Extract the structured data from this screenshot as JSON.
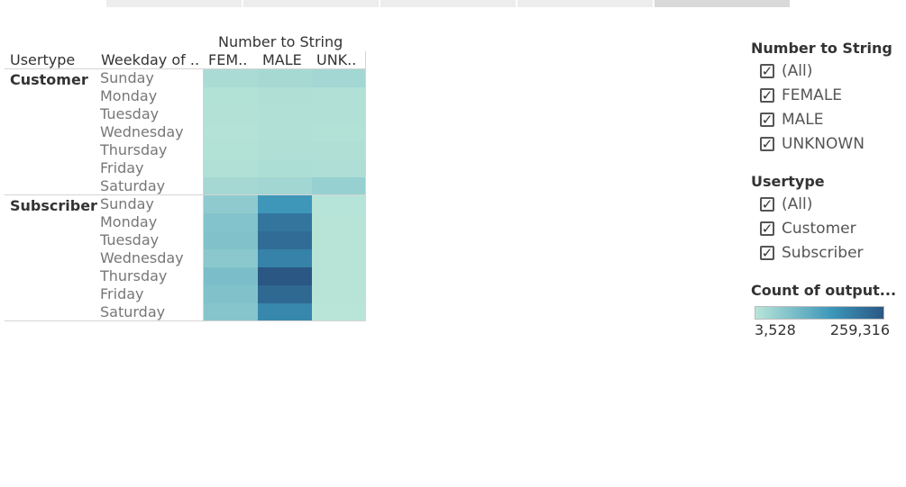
{
  "chart_data": {
    "type": "heatmap",
    "column_header_title": "Number to String",
    "row_header_1": "Usertype",
    "row_header_2": "Weekday of ..",
    "column_labels": [
      "FEM..",
      "MALE",
      "UNK.."
    ],
    "groups": [
      {
        "usertype": "Customer",
        "rows": [
          {
            "weekday": "Sunday",
            "values": [
              22000,
              26000,
              30000
            ]
          },
          {
            "weekday": "Monday",
            "values": [
              12000,
              15000,
              14000
            ]
          },
          {
            "weekday": "Tuesday",
            "values": [
              11000,
              14000,
              13000
            ]
          },
          {
            "weekday": "Wednesday",
            "values": [
              10000,
              13000,
              12000
            ]
          },
          {
            "weekday": "Thursday",
            "values": [
              12000,
              15000,
              15000
            ]
          },
          {
            "weekday": "Friday",
            "values": [
              14000,
              18000,
              17000
            ]
          },
          {
            "weekday": "Saturday",
            "values": [
              28000,
              32000,
              45000
            ]
          }
        ]
      },
      {
        "usertype": "Subscriber",
        "rows": [
          {
            "weekday": "Sunday",
            "values": [
              55000,
              155000,
              6000
            ]
          },
          {
            "weekday": "Monday",
            "values": [
              70000,
              210000,
              5000
            ]
          },
          {
            "weekday": "Tuesday",
            "values": [
              72000,
              225000,
              5000
            ]
          },
          {
            "weekday": "Wednesday",
            "values": [
              60000,
              190000,
              5000
            ]
          },
          {
            "weekday": "Thursday",
            "values": [
              80000,
              259316,
              5000
            ]
          },
          {
            "weekday": "Friday",
            "values": [
              72000,
              230000,
              5000
            ]
          },
          {
            "weekday": "Saturday",
            "values": [
              65000,
              180000,
              3528
            ]
          }
        ]
      }
    ],
    "color_scale": {
      "min": 3528,
      "max": 259316,
      "low_color": "#b9e5d8",
      "high_color": "#2a5783"
    }
  },
  "filters": [
    {
      "title": "Number to String",
      "items": [
        "(All)",
        "FEMALE",
        "MALE",
        "UNKNOWN"
      ]
    },
    {
      "title": "Usertype",
      "items": [
        "(All)",
        "Customer",
        "Subscriber"
      ]
    }
  ],
  "checkmark": "✓",
  "color_legend": {
    "title": "Count of output...",
    "min_label": "3,528",
    "max_label": "259,316"
  }
}
